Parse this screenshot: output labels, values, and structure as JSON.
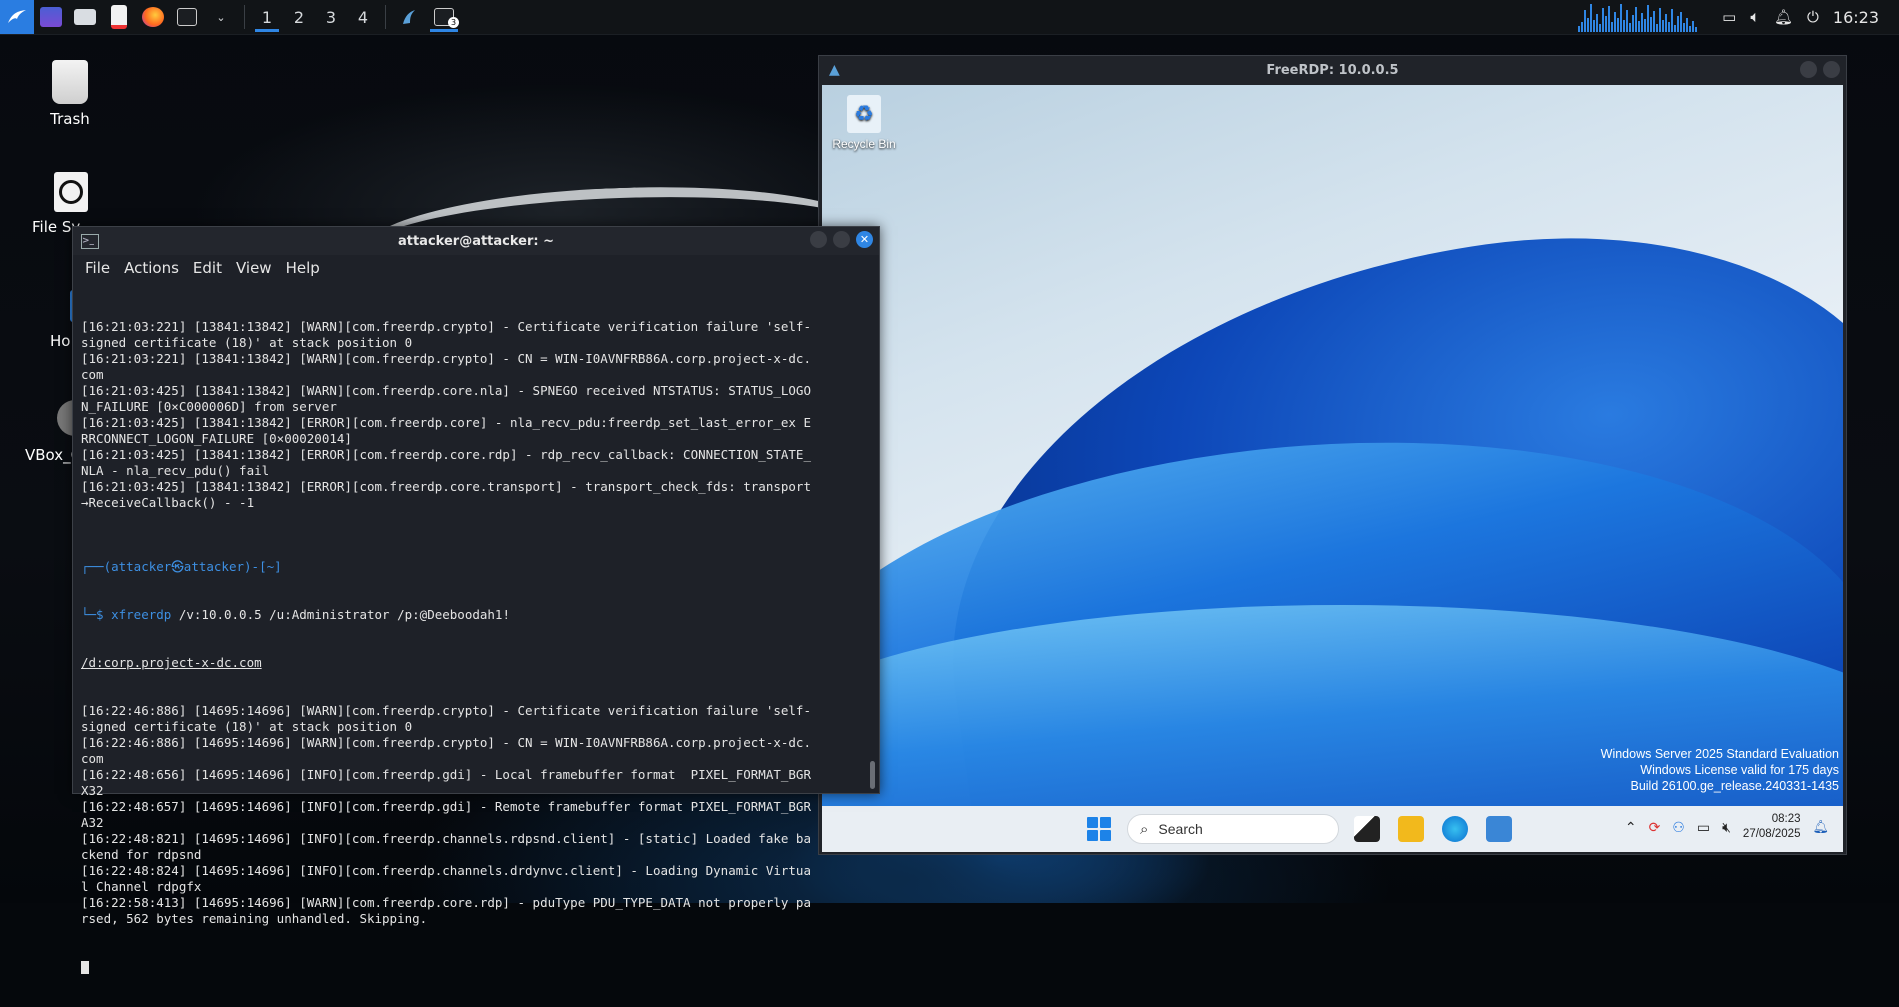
{
  "top_panel": {
    "workspaces": [
      "1",
      "2",
      "3",
      "4"
    ],
    "active_workspace": "1",
    "terminal_badge": "3",
    "clock": "16:23",
    "accent_color": "#2f86e4"
  },
  "desktop_icons": [
    {
      "label": "Trash",
      "icon": "trash-icon"
    },
    {
      "label": "File Sy",
      "icon": "filesystem-icon"
    },
    {
      "label": "Ho",
      "icon": "home-folder-icon"
    },
    {
      "label": "VBox_G",
      "icon": "vbox-disc-icon"
    }
  ],
  "terminal": {
    "title": "attacker@attacker: ~",
    "menu": [
      "File",
      "Actions",
      "Edit",
      "View",
      "Help"
    ],
    "lines_before": [
      "[16:21:03:221] [13841:13842] [WARN][com.freerdp.crypto] - Certificate verification failure 'self-",
      "signed certificate (18)' at stack position 0",
      "[16:21:03:221] [13841:13842] [WARN][com.freerdp.crypto] - CN = WIN-I0AVNFRB86A.corp.project-x-dc.",
      "com",
      "[16:21:03:425] [13841:13842] [WARN][com.freerdp.core.nla] - SPNEGO received NTSTATUS: STATUS_LOGO",
      "N_FAILURE [0×C000006D] from server",
      "[16:21:03:425] [13841:13842] [ERROR][com.freerdp.core] - nla_recv_pdu:freerdp_set_last_error_ex E",
      "RRCONNECT_LOGON_FAILURE [0×00020014]",
      "[16:21:03:425] [13841:13842] [ERROR][com.freerdp.core.rdp] - rdp_recv_callback: CONNECTION_STATE_",
      "NLA - nla_recv_pdu() fail",
      "[16:21:03:425] [13841:13842] [ERROR][com.freerdp.core.transport] - transport_check_fds: transport",
      "→ReceiveCallback() - -1",
      ""
    ],
    "prompt_line": "┌──(attacker㉿attacker)-[~]",
    "command_prefix": "└─$ ",
    "command_name": "xfreerdp",
    "command_args": " /v:10.0.0.5 /u:Administrator /p:@Deeboodah1!",
    "command_wrap": "/d:corp.project-x-dc.com",
    "lines_after": [
      "[16:22:46:886] [14695:14696] [WARN][com.freerdp.crypto] - Certificate verification failure 'self-",
      "signed certificate (18)' at stack position 0",
      "[16:22:46:886] [14695:14696] [WARN][com.freerdp.crypto] - CN = WIN-I0AVNFRB86A.corp.project-x-dc.",
      "com",
      "[16:22:48:656] [14695:14696] [INFO][com.freerdp.gdi] - Local framebuffer format  PIXEL_FORMAT_BGR",
      "X32",
      "[16:22:48:657] [14695:14696] [INFO][com.freerdp.gdi] - Remote framebuffer format PIXEL_FORMAT_BGR",
      "A32",
      "[16:22:48:821] [14695:14696] [INFO][com.freerdp.channels.rdpsnd.client] - [static] Loaded fake ba",
      "ckend for rdpsnd",
      "[16:22:48:824] [14695:14696] [INFO][com.freerdp.channels.drdynvc.client] - Loading Dynamic Virtua",
      "l Channel rdpgfx",
      "[16:22:58:413] [14695:14696] [WARN][com.freerdp.core.rdp] - pduType PDU_TYPE_DATA not properly pa",
      "rsed, 562 bytes remaining unhandled. Skipping."
    ]
  },
  "rdp_window": {
    "title": "FreeRDP: 10.0.0.5",
    "recycle_bin_label": "Recycle Bin",
    "watermark": [
      "Windows Server 2025 Standard Evaluation",
      "Windows License valid for 175 days",
      "Build 26100.ge_release.240331-1435"
    ],
    "search_placeholder": "Search",
    "taskbar_time": "08:23",
    "taskbar_date": "27/08/2025"
  }
}
